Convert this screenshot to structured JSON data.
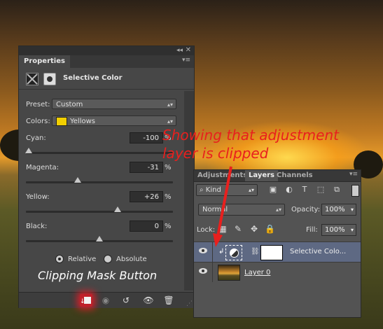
{
  "properties": {
    "tab_label": "Properties",
    "collapse_glyph": "◂◂",
    "close_glyph": "✕",
    "menu_glyph": "▾≡",
    "adjustment_title": "Selective Color",
    "preset_label": "Preset:",
    "preset_value": "Custom",
    "colors_label": "Colors:",
    "colors_value": "Yellows",
    "colors_swatch": "#f2cf00",
    "sliders": [
      {
        "label": "Cyan:",
        "value": "-100",
        "unit": "%",
        "level": -100
      },
      {
        "label": "Magenta:",
        "value": "-31",
        "unit": "%",
        "level": -31
      },
      {
        "label": "Yellow:",
        "value": "+26",
        "unit": "%",
        "level": 26
      },
      {
        "label": "Black:",
        "value": "0",
        "unit": "%",
        "level": 0
      }
    ],
    "method_relative": "Relative",
    "method_absolute": "Absolute",
    "method_selected": "Relative"
  },
  "caption_text": "Clipping Mask Button",
  "annotation": {
    "line1": "Showing that adjustment",
    "line2": "layer is clipped",
    "color": "#e8201e"
  },
  "layers_panel": {
    "tabs": [
      "Adjustments",
      "Layers",
      "Channels"
    ],
    "active_tab": "Layers",
    "menu_glyph": "▾≡",
    "filter_kind": "Kind",
    "blend_mode": "Normal",
    "opacity_label": "Opacity:",
    "opacity_value": "100%",
    "lock_label": "Lock:",
    "fill_label": "Fill:",
    "fill_value": "100%",
    "layers": [
      {
        "name": "Selective Colo...",
        "type": "adjustment",
        "selected": true,
        "clipped": true
      },
      {
        "name": "Layer 0",
        "type": "image",
        "selected": false,
        "clipped": false
      }
    ]
  }
}
